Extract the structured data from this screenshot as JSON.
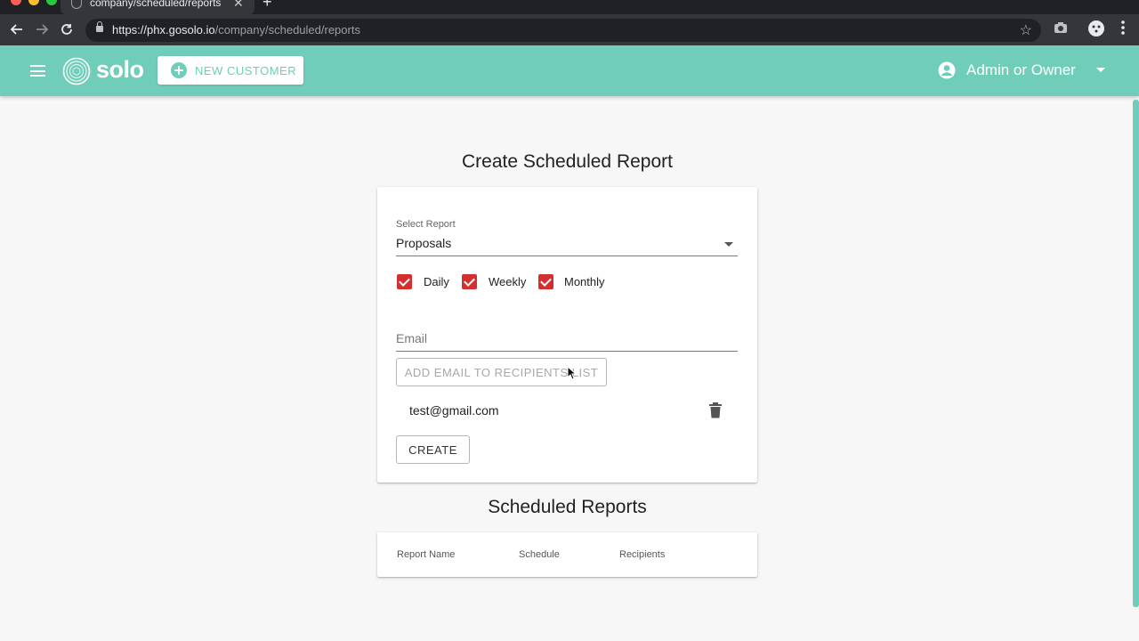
{
  "browser": {
    "tab_title": "company/scheduled/reports",
    "tab_close": "✕",
    "new_tab": "+",
    "url_host": "https://phx.gosolo.io",
    "url_path": "/company/scheduled/reports"
  },
  "header": {
    "logo_text": "solo",
    "new_customer_label": "NEW CUSTOMER",
    "user_label": "Admin or Owner"
  },
  "create_form": {
    "title": "Create Scheduled Report",
    "select_label": "Select Report",
    "select_value": "Proposals",
    "schedules": [
      {
        "label": "Daily",
        "checked": true
      },
      {
        "label": "Weekly",
        "checked": true
      },
      {
        "label": "Monthly",
        "checked": true
      }
    ],
    "email_placeholder": "Email",
    "add_email_label": "ADD EMAIL TO RECIPIENTS LIST",
    "recipients": [
      "test@gmail.com"
    ],
    "create_label": "CREATE"
  },
  "scheduled_reports": {
    "title": "Scheduled Reports",
    "columns": [
      "Report Name",
      "Schedule",
      "Recipients"
    ]
  },
  "colors": {
    "brand": "#6fcdb9",
    "checkbox": "#d32f2f"
  }
}
